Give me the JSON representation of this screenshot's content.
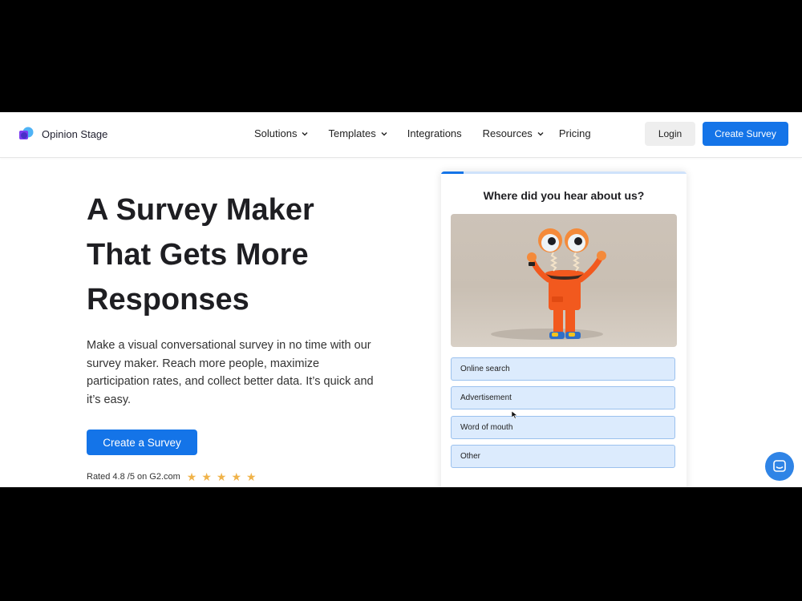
{
  "header": {
    "logo_text": "Opinion Stage",
    "nav": [
      {
        "label": "Solutions",
        "has_dropdown": true,
        "icon": "chevron-down-icon"
      },
      {
        "label": "Templates",
        "has_dropdown": true,
        "icon": "chevron-down-icon"
      },
      {
        "label": "Integrations",
        "has_dropdown": false
      },
      {
        "label": "Resources",
        "has_dropdown": true,
        "icon": "chevron-down-icon"
      },
      {
        "label": "Pricing",
        "has_dropdown": false
      }
    ],
    "login_label": "Login",
    "create_label": "Create Survey"
  },
  "hero": {
    "title": "A Survey Maker That Gets More Responses",
    "description": "Make a visual conversational survey in no time with our survey maker. Reach more people, maximize participation rates, and collect better data. It’s quick and it’s easy.",
    "cta_label": "Create a Survey",
    "rating_text": "Rated 4.8 /5 on G2.com",
    "rating_value": 4.8,
    "rating_max": 5,
    "stars_shown": 5
  },
  "survey_card": {
    "progress_fraction": 0.09,
    "question": "Where did you hear about us?",
    "image_icon": "cartoon-character-illustration",
    "options": [
      "Online search",
      "Advertisement",
      "Word of mouth",
      "Other"
    ]
  },
  "chat": {
    "icon": "chat-icon"
  },
  "colors": {
    "primary": "#1474e8",
    "option_bg": "#dcebfd",
    "option_border": "#9bc1ee",
    "star": "#f0b34a",
    "character_orange": "#f2591e"
  }
}
